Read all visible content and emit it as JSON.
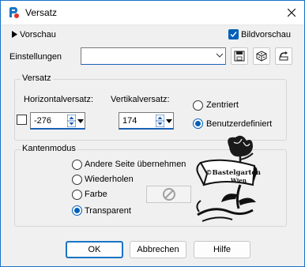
{
  "window": {
    "title": "Versatz",
    "accent_color": "#1a73c6",
    "close_icon": "close-icon"
  },
  "top": {
    "preview_toggle_label": "Vorschau",
    "image_preview_label": "Bildvorschau",
    "image_preview_checked": true
  },
  "settings": {
    "label": "Einstellungen",
    "combo_value": "",
    "icons": [
      "save-preset-icon",
      "random-dice-icon",
      "reset-icon"
    ]
  },
  "offset": {
    "group_label": "Versatz",
    "horizontal_label": "Horizontalversatz:",
    "horizontal_value": "-276",
    "vertical_label": "Vertikalversatz:",
    "vertical_value": "174",
    "link_checked": false,
    "centered_label": "Zentriert",
    "custom_label": "Benutzerdefiniert",
    "selected": "custom"
  },
  "edge_mode": {
    "group_label": "Kantenmodus",
    "options": [
      "Andere Seite übernehmen",
      "Wiederholen",
      "Farbe",
      "Transparent"
    ],
    "selected": "Transparent",
    "color_swatch_icon": "no-color-icon"
  },
  "watermark": {
    "line1": "©Bastelgarten",
    "line2": "Wien"
  },
  "buttons": {
    "ok": "OK",
    "cancel": "Abbrechen",
    "help": "Hilfe"
  }
}
